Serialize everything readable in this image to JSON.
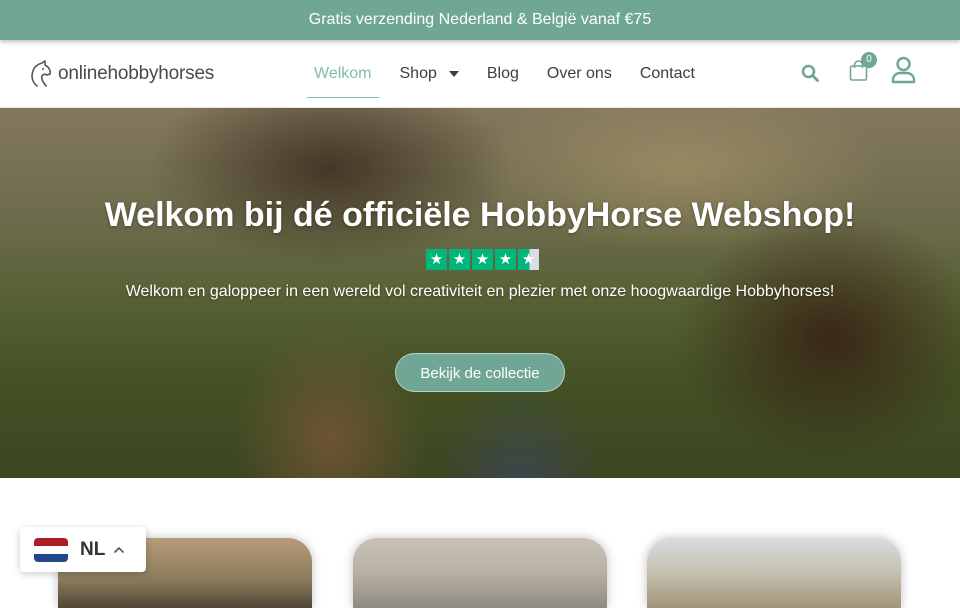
{
  "promo_bar": {
    "text": "Gratis verzending Nederland & België vanaf €75"
  },
  "header": {
    "logo": {
      "text": "onlinehobbyhorses",
      "icon": "horse-head-icon"
    },
    "nav": [
      {
        "label": "Welkom",
        "active": true
      },
      {
        "label": "Shop",
        "has_dropdown": true
      },
      {
        "label": "Blog"
      },
      {
        "label": "Over ons"
      },
      {
        "label": "Contact"
      }
    ],
    "icons": {
      "search": "search-icon",
      "cart": "shopping-bag-icon",
      "account": "user-icon"
    },
    "cart_count": "0"
  },
  "hero": {
    "title": "Welkom bij dé officiële HobbyHorse Webshop!",
    "rating": {
      "stars": 4.5,
      "max": 5
    },
    "subtitle": "Welkom en galoppeer in een wereld vol creativiteit en plezier met onze hoogwaardige Hobbyhorses!",
    "button": "Bekijk de collectie"
  },
  "language_switcher": {
    "code": "NL",
    "flag": "netherlands-flag",
    "icon": "chevron-up-icon"
  },
  "colors": {
    "accent": "#6fa695",
    "active_nav": "#7fbfa8",
    "trustpilot": "#00b67a",
    "text": "#3d3d3d"
  }
}
